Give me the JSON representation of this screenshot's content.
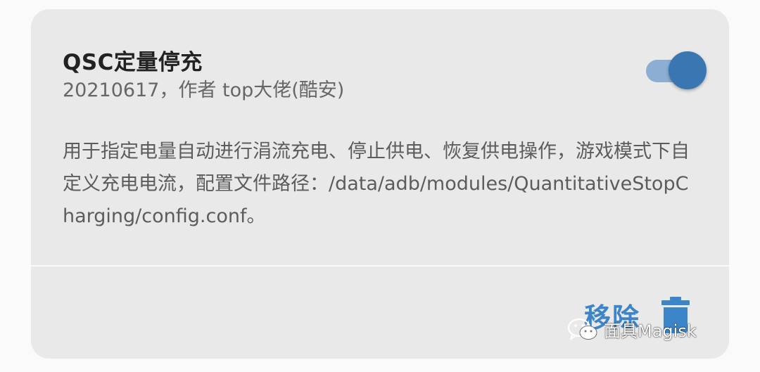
{
  "module": {
    "title": "QSC定量停充",
    "meta": "20210617，作者 top大佬(酷安)",
    "description": "用于指定电量自动进行涓流充电、停止供电、恢复供电操作，游戏模式下自定义充电电流，配置文件路径：/data/adb/modules/QuantitativeStopCharging/config.conf。",
    "enabled": true
  },
  "actions": {
    "remove_label": "移除",
    "remove_icon": "trash-icon"
  },
  "watermark": {
    "text": "面具Magisk",
    "icon": "wechat-icon"
  },
  "colors": {
    "accent": "#3c85c8",
    "toggle_thumb": "#3a76b2",
    "toggle_track": "#8caed2",
    "card_background": "#e9e9e9"
  }
}
